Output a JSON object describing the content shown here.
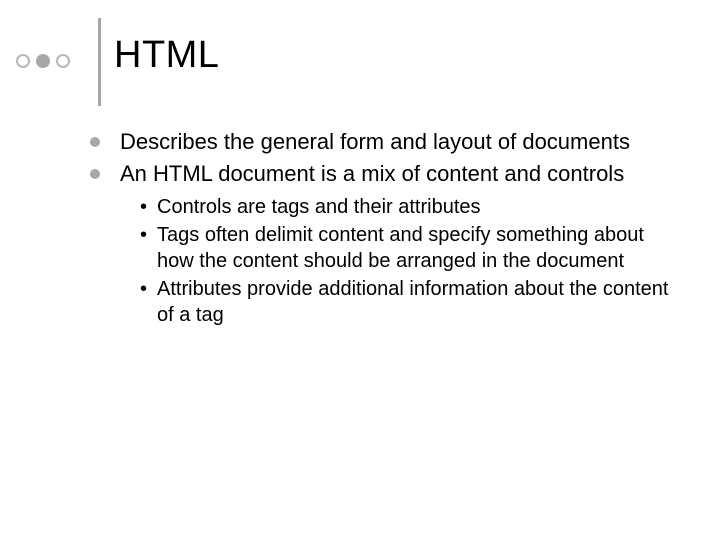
{
  "title": "HTML",
  "bullets": [
    {
      "text": "Describes the general form and layout of documents",
      "sub": []
    },
    {
      "text": "An HTML document is a mix of content and controls",
      "sub": [
        "Controls are tags and their attributes",
        "Tags often delimit content and specify something about how the content should be arranged in the document",
        "Attributes provide additional information about the content of a tag"
      ]
    }
  ]
}
